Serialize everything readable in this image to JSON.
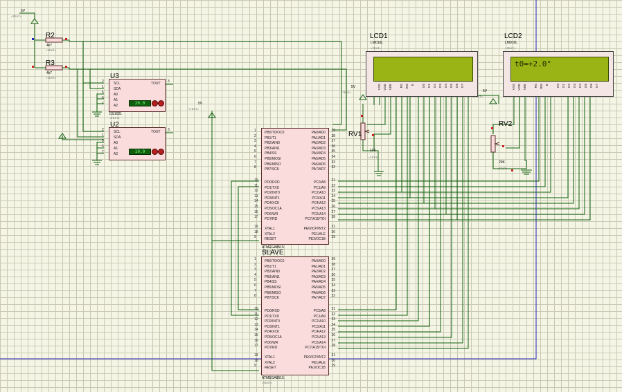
{
  "supply_label": "5V",
  "text_placeholder": "<TEXT>",
  "resistors": [
    {
      "ref": "R2",
      "value": "4k7"
    },
    {
      "ref": "R3",
      "value": "4k7"
    }
  ],
  "sensors": [
    {
      "ref": "U3",
      "part": "DS1621",
      "display": "20.0",
      "pins_left": [
        "SCL",
        "SDA",
        "A0",
        "A1",
        "A2"
      ],
      "pin_nums_left": [
        "2",
        "1",
        "5",
        "6",
        "7"
      ],
      "pin_right": "TOUT",
      "pin_num_right": "3"
    },
    {
      "ref": "U2",
      "part": "DS1621",
      "display": "10.0",
      "pins_left": [
        "SCL",
        "SDA",
        "A0",
        "A1",
        "A2"
      ],
      "pin_nums_left": [
        "2",
        "1",
        "5",
        "6",
        "7"
      ],
      "pin_right": "TOUT",
      "pin_num_right": "3"
    }
  ],
  "pots": [
    {
      "ref": "RV1",
      "value": "10K"
    },
    {
      "ref": "RV2",
      "value": "20K"
    }
  ],
  "lcds": [
    {
      "ref": "LCD1",
      "part": "LM016L",
      "display": ""
    },
    {
      "ref": "LCD2",
      "part": "LM016L",
      "display": "t0=+2.0°"
    }
  ],
  "lcd_pins": [
    "VSS",
    "VDD",
    "VEE",
    "RS",
    "RW",
    "E",
    "D0",
    "D1",
    "D2",
    "D3",
    "D4",
    "D5",
    "D6",
    "D7"
  ],
  "mcu_master": {
    "part": "ATMEGA8515",
    "label": ""
  },
  "mcu_slave": {
    "part": "ATMEGA8515",
    "label": "SLAVE"
  },
  "mcu_left_pins": [
    {
      "num": "1",
      "name": "PB0/T0/OC0"
    },
    {
      "num": "2",
      "name": "PB1/T1"
    },
    {
      "num": "3",
      "name": "PB2/AIN0"
    },
    {
      "num": "4",
      "name": "PB3/AIN1"
    },
    {
      "num": "5",
      "name": "PB4/SS"
    },
    {
      "num": "6",
      "name": "PB5/MOSI"
    },
    {
      "num": "7",
      "name": "PB6/MISO"
    },
    {
      "num": "8",
      "name": "PB7/SCK"
    },
    {
      "num": "10",
      "name": "PD0/RXD"
    },
    {
      "num": "11",
      "name": "PD1/TXD"
    },
    {
      "num": "12",
      "name": "PD2/INT0"
    },
    {
      "num": "13",
      "name": "PD3/INT1"
    },
    {
      "num": "14",
      "name": "PD4/XCK"
    },
    {
      "num": "15",
      "name": "PD5/OC1A"
    },
    {
      "num": "16",
      "name": "PD6/WR"
    },
    {
      "num": "17",
      "name": "PD7/RD"
    },
    {
      "num": "19",
      "name": "XTAL1"
    },
    {
      "num": "18",
      "name": "XTAL2"
    },
    {
      "num": "9",
      "name": "RESET"
    }
  ],
  "mcu_right_pins": [
    {
      "num": "39",
      "name": "PA0/AD0"
    },
    {
      "num": "38",
      "name": "PA1/AD1"
    },
    {
      "num": "37",
      "name": "PA2/AD2"
    },
    {
      "num": "36",
      "name": "PA3/AD3"
    },
    {
      "num": "35",
      "name": "PA4/AD4"
    },
    {
      "num": "34",
      "name": "PA5/AD5"
    },
    {
      "num": "33",
      "name": "PA6/AD6"
    },
    {
      "num": "32",
      "name": "PA7/AD7"
    },
    {
      "num": "21",
      "name": "PC0/A8"
    },
    {
      "num": "22",
      "name": "PC1/A9"
    },
    {
      "num": "23",
      "name": "PC2/A10"
    },
    {
      "num": "24",
      "name": "PC3/A11"
    },
    {
      "num": "25",
      "name": "PC4/A12"
    },
    {
      "num": "26",
      "name": "PC5/A13"
    },
    {
      "num": "27",
      "name": "PC6/A14"
    },
    {
      "num": "28",
      "name": "PC7/A15/TOI"
    },
    {
      "num": "31",
      "name": "PE0/ICP/INT2"
    },
    {
      "num": "30",
      "name": "PE1/ALE"
    },
    {
      "num": "29",
      "name": "PE2/OC1B"
    }
  ],
  "colors": {
    "wire": "#0b5e0b",
    "chip_fill": "#fadcdc",
    "chip_border": "#5a2c2c",
    "lcd_screen": "#99b414",
    "sheet_border": "#1f1fb4",
    "pin_marker_red": "#cc2222",
    "pin_marker_blue": "#2222cc"
  }
}
